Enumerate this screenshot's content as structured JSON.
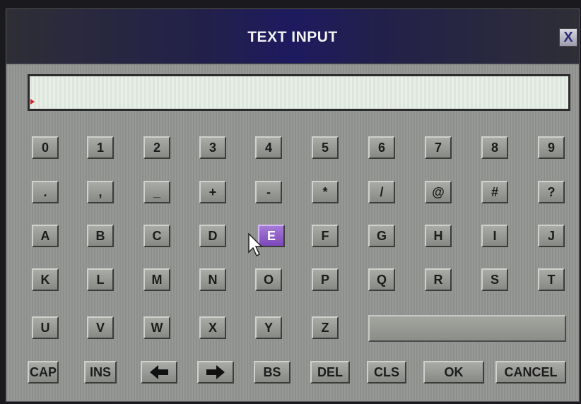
{
  "dialog": {
    "title": "TEXT INPUT",
    "close_label": "X",
    "text_value": ""
  },
  "keyboard": {
    "rows": [
      [
        "0",
        "1",
        "2",
        "3",
        "4",
        "5",
        "6",
        "7",
        "8",
        "9"
      ],
      [
        ".",
        ",",
        "_",
        "+",
        "-",
        "*",
        "/",
        "@",
        "#",
        "?"
      ],
      [
        "A",
        "B",
        "C",
        "D",
        "E",
        "F",
        "G",
        "H",
        "I",
        "J"
      ],
      [
        "K",
        "L",
        "M",
        "N",
        "O",
        "P",
        "Q",
        "R",
        "S",
        "T"
      ],
      [
        "U",
        "V",
        "W",
        "X",
        "Y",
        "Z"
      ]
    ],
    "selected_key": "E",
    "controls": {
      "cap": "CAP",
      "ins": "INS",
      "left_arrow_icon": "arrow-left-icon",
      "right_arrow_icon": "arrow-right-icon",
      "bs": "BS",
      "del": "DEL",
      "cls": "CLS",
      "ok": "OK",
      "cancel": "CANCEL"
    }
  },
  "colors": {
    "title_bar": "#1e1a60",
    "selected_key": "#9a66d0",
    "caret": "#d0202a"
  }
}
